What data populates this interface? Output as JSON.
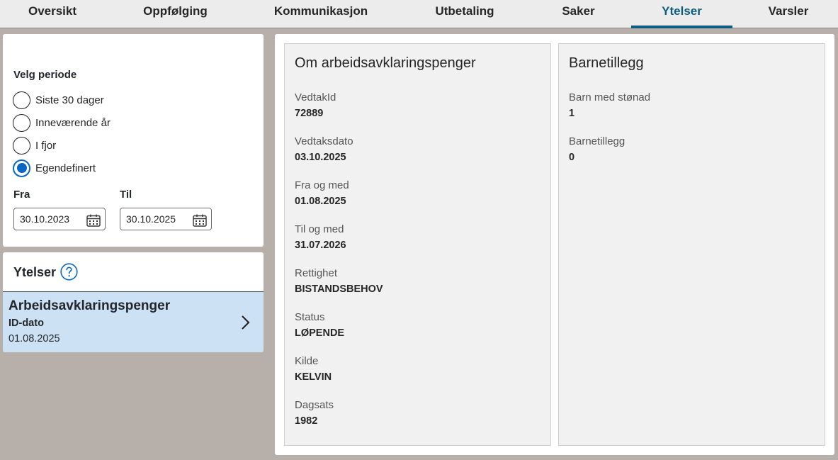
{
  "tabs": [
    {
      "label": "Oversikt"
    },
    {
      "label": "Oppfølging"
    },
    {
      "label": "Kommunikasjon"
    },
    {
      "label": "Utbetaling"
    },
    {
      "label": "Saker"
    },
    {
      "label": "Ytelser",
      "active": true
    },
    {
      "label": "Varsler"
    }
  ],
  "filter": {
    "title": "Velg periode",
    "options": [
      {
        "label": "Siste 30 dager",
        "checked": false
      },
      {
        "label": "Inneværende år",
        "checked": false
      },
      {
        "label": "I fjor",
        "checked": false
      },
      {
        "label": "Egendefinert",
        "checked": true
      }
    ],
    "from_label": "Fra",
    "from_value": "30.10.2023",
    "to_label": "Til",
    "to_value": "30.10.2025"
  },
  "ytelser": {
    "heading": "Ytelser",
    "items": [
      {
        "title": "Arbeidsavklaringspenger",
        "sub_label": "ID-dato",
        "date": "01.08.2025"
      }
    ]
  },
  "details": {
    "title": "Om arbeidsavklaringspenger",
    "fields": [
      {
        "label": "VedtakId",
        "value": "72889"
      },
      {
        "label": "Vedtaksdato",
        "value": "03.10.2025"
      },
      {
        "label": "Fra og med",
        "value": "01.08.2025"
      },
      {
        "label": "Til og med",
        "value": "31.07.2026"
      },
      {
        "label": "Rettighet",
        "value": "BISTANDSBEHOV"
      },
      {
        "label": "Status",
        "value": "LØPENDE"
      },
      {
        "label": "Kilde",
        "value": "KELVIN"
      },
      {
        "label": "Dagsats",
        "value": "1982"
      }
    ]
  },
  "barnetillegg": {
    "title": "Barnetillegg",
    "fields": [
      {
        "label": "Barn med stønad",
        "value": "1"
      },
      {
        "label": "Barnetillegg",
        "value": "0"
      }
    ]
  },
  "colors": {
    "accent": "#0d5f82",
    "radio": "#0a66c2",
    "selected_row": "#cce1f3",
    "background": "#b7b0aa"
  },
  "icons": [
    "calendar-icon",
    "help-circle-icon",
    "chevron-right-icon"
  ]
}
